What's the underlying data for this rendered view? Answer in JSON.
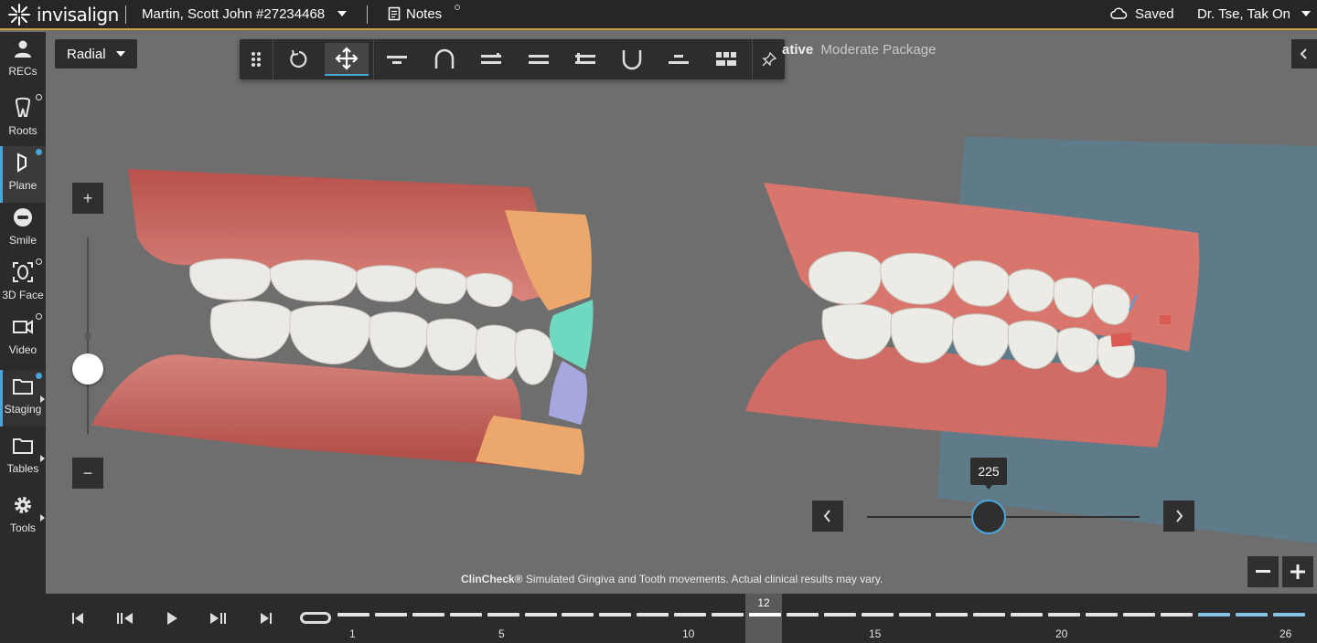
{
  "topbar": {
    "logo": "invisalign",
    "patient": "Martin, Scott John #27234468",
    "notes": "Notes",
    "saved": "Saved",
    "doctor": "Dr. Tse, Tak On",
    "accent": "#c9a048"
  },
  "sidebar": {
    "items": [
      {
        "label": "RECs",
        "icon": "person-icon"
      },
      {
        "label": "Roots",
        "icon": "tooth-icon"
      },
      {
        "label": "Plane",
        "icon": "plane-icon"
      },
      {
        "label": "Smile",
        "icon": "smile-icon"
      },
      {
        "label": "3D Face",
        "icon": "face-scan-icon"
      },
      {
        "label": "Video",
        "icon": "video-icon"
      },
      {
        "label": "Staging",
        "icon": "folder-icon"
      },
      {
        "label": "Tables",
        "icon": "folder-icon"
      },
      {
        "label": "Tools",
        "icon": "gear-icon"
      }
    ],
    "active": "Plane"
  },
  "view": {
    "radial_label": "Radial",
    "package_prefix": "ative",
    "package_name": "Moderate Package",
    "toolbar_icons": [
      "drag-handle-icon",
      "rotate-icon",
      "move-icon",
      "occlusal-plane-icon",
      "arch-icon",
      "parallel-lines-icon",
      "double-line-icon",
      "stacked-lines-icon",
      "u-shape-icon",
      "centered-line-icon",
      "grid-icon",
      "pin-icon"
    ],
    "zoom_in": "+",
    "zoom_out": "−",
    "stage_value": "225",
    "stage_fraction": 0.45,
    "zoom_level": 0.45,
    "disclaimer_brand": "ClinCheck®",
    "disclaimer_text": "Simulated Gingiva and Tooth movements. Actual clinical results may vary."
  },
  "timeline": {
    "current_stage": "12",
    "tick_labels": [
      "1",
      "5",
      "10",
      "15",
      "20",
      "26"
    ],
    "total_stages": 26,
    "blue_from": 24
  }
}
